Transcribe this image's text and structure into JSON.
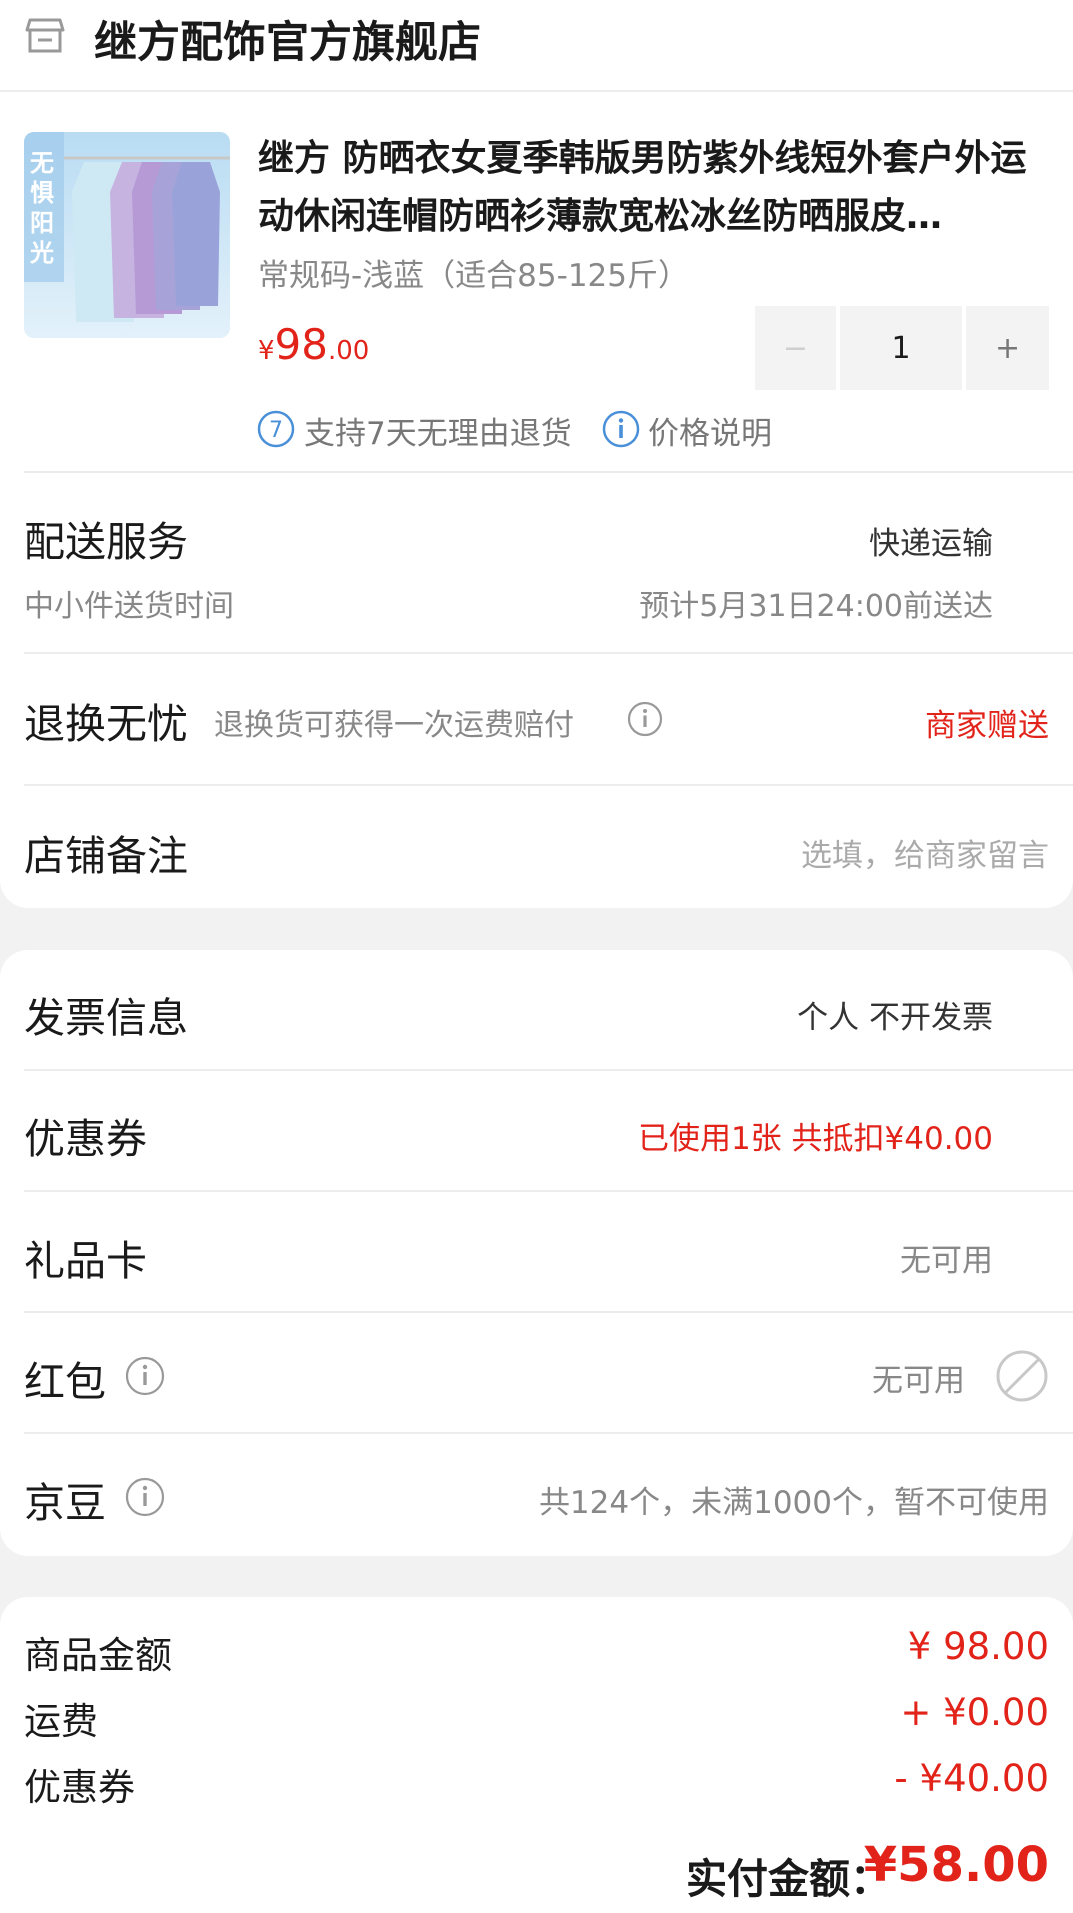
{
  "store": {
    "name": "继方配饰官方旗舰店",
    "icon": "store-icon"
  },
  "product": {
    "thumb_text": "无惧阳光",
    "title": "继方 防晒衣女夏季韩版男防紫外线短外套户外运动休闲连帽防晒衫薄款宽松冰丝防晒服皮…",
    "spec": "常规码-浅蓝（适合85-125斤）",
    "price_currency": "¥",
    "price_int": "98",
    "price_dec": ".00",
    "quantity": "1",
    "minus_label": "−",
    "plus_label": "+",
    "service_return": "支持7天无理由退货",
    "service_return_icon_text": "7",
    "service_price": "价格说明"
  },
  "delivery": {
    "label": "配送服务",
    "value": "快递运输",
    "sub_label": "中小件送货时间",
    "sub_value": "预计5月31日24:00前送达"
  },
  "return_worry": {
    "label": "退换无忧",
    "desc": "退换货可获得一次运费赔付",
    "value": "商家赠送"
  },
  "note": {
    "label": "店铺备注",
    "placeholder": "选填，给商家留言"
  },
  "invoice": {
    "label": "发票信息",
    "value": "个人 不开发票"
  },
  "coupon": {
    "label": "优惠券",
    "value": "已使用1张 共抵扣¥40.00"
  },
  "gift_card": {
    "label": "礼品卡",
    "value": "无可用"
  },
  "red_packet": {
    "label": "红包",
    "value": "无可用"
  },
  "jd_beans": {
    "label": "京豆",
    "value": "共124个，未满1000个，暂不可使用"
  },
  "summary": {
    "goods_label": "商品金额",
    "goods_value": "¥ 98.00",
    "shipping_label": "运费",
    "shipping_value": "+ ¥0.00",
    "coupon_label": "优惠券",
    "coupon_value": "- ¥40.00",
    "total_label": "实付金额：",
    "total_value": "¥58.00"
  },
  "colors": {
    "accent": "#e2231a",
    "info_blue": "#4a90d9",
    "background": "#f2f2f2"
  }
}
